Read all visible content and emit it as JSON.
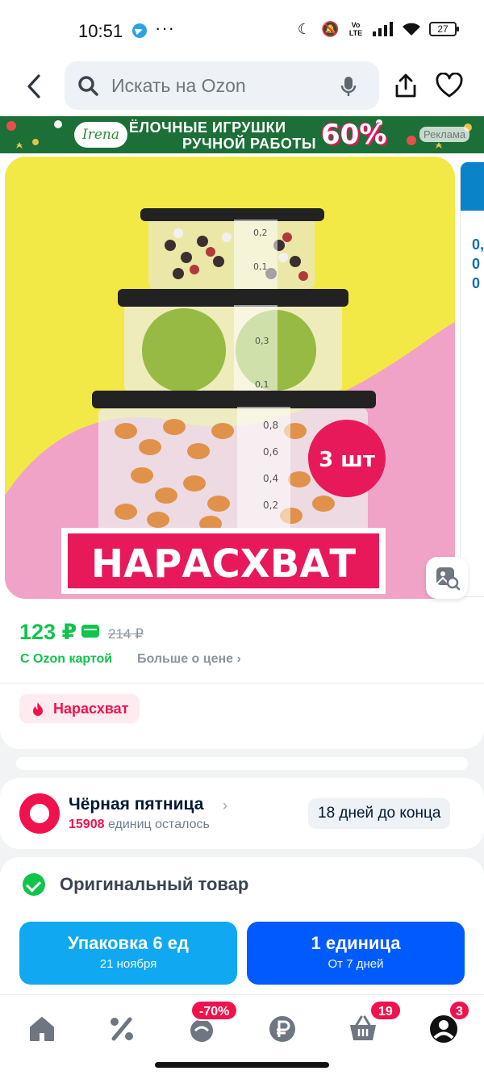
{
  "status_bar": {
    "time": "10:51",
    "dots": "···",
    "battery": "27"
  },
  "search": {
    "placeholder": "Искать на Ozon"
  },
  "banner": {
    "brand": "Irena",
    "line1": "ЁЛОЧНЫЕ ИГРУШКИ",
    "line2": "РУЧНОЙ РАБОТЫ",
    "discount": "60%",
    "ad_label": "Реклама"
  },
  "product_image": {
    "badge": "3 шт",
    "slogan": "НАРАСХВАТ",
    "scale_top": [
      "0,2",
      "0,1"
    ],
    "scale_mid": [
      "0,3",
      "0,1"
    ],
    "scale_bottom": [
      "0,8",
      "0,6",
      "0,4",
      "0,2"
    ]
  },
  "side_card": {
    "texts": [
      "0,",
      "0",
      "0"
    ]
  },
  "price": {
    "current": "123 ₽",
    "old": "214 ₽",
    "ozon_card": "С Ozon картой",
    "more": "Больше о цене ›"
  },
  "hot_badge": "Нарасхват",
  "black_friday": {
    "title": "Чёрная пятница",
    "chevron": "›",
    "count": "15908",
    "count_suffix": "единиц осталось",
    "days_left": "18 дней до конца"
  },
  "original": "Оригинальный товар",
  "buttons": [
    {
      "title": "Упаковка 6 ед",
      "subtitle": "21 ноября"
    },
    {
      "title": "1 единица",
      "subtitle": "От 7 дней"
    }
  ],
  "nav": {
    "sale_badge": "-70%",
    "cart_badge": "19",
    "profile_badge": "3"
  },
  "colors": {
    "ozon_blue": "#005bff",
    "green": "#10c44c",
    "pink": "#f1124d"
  }
}
